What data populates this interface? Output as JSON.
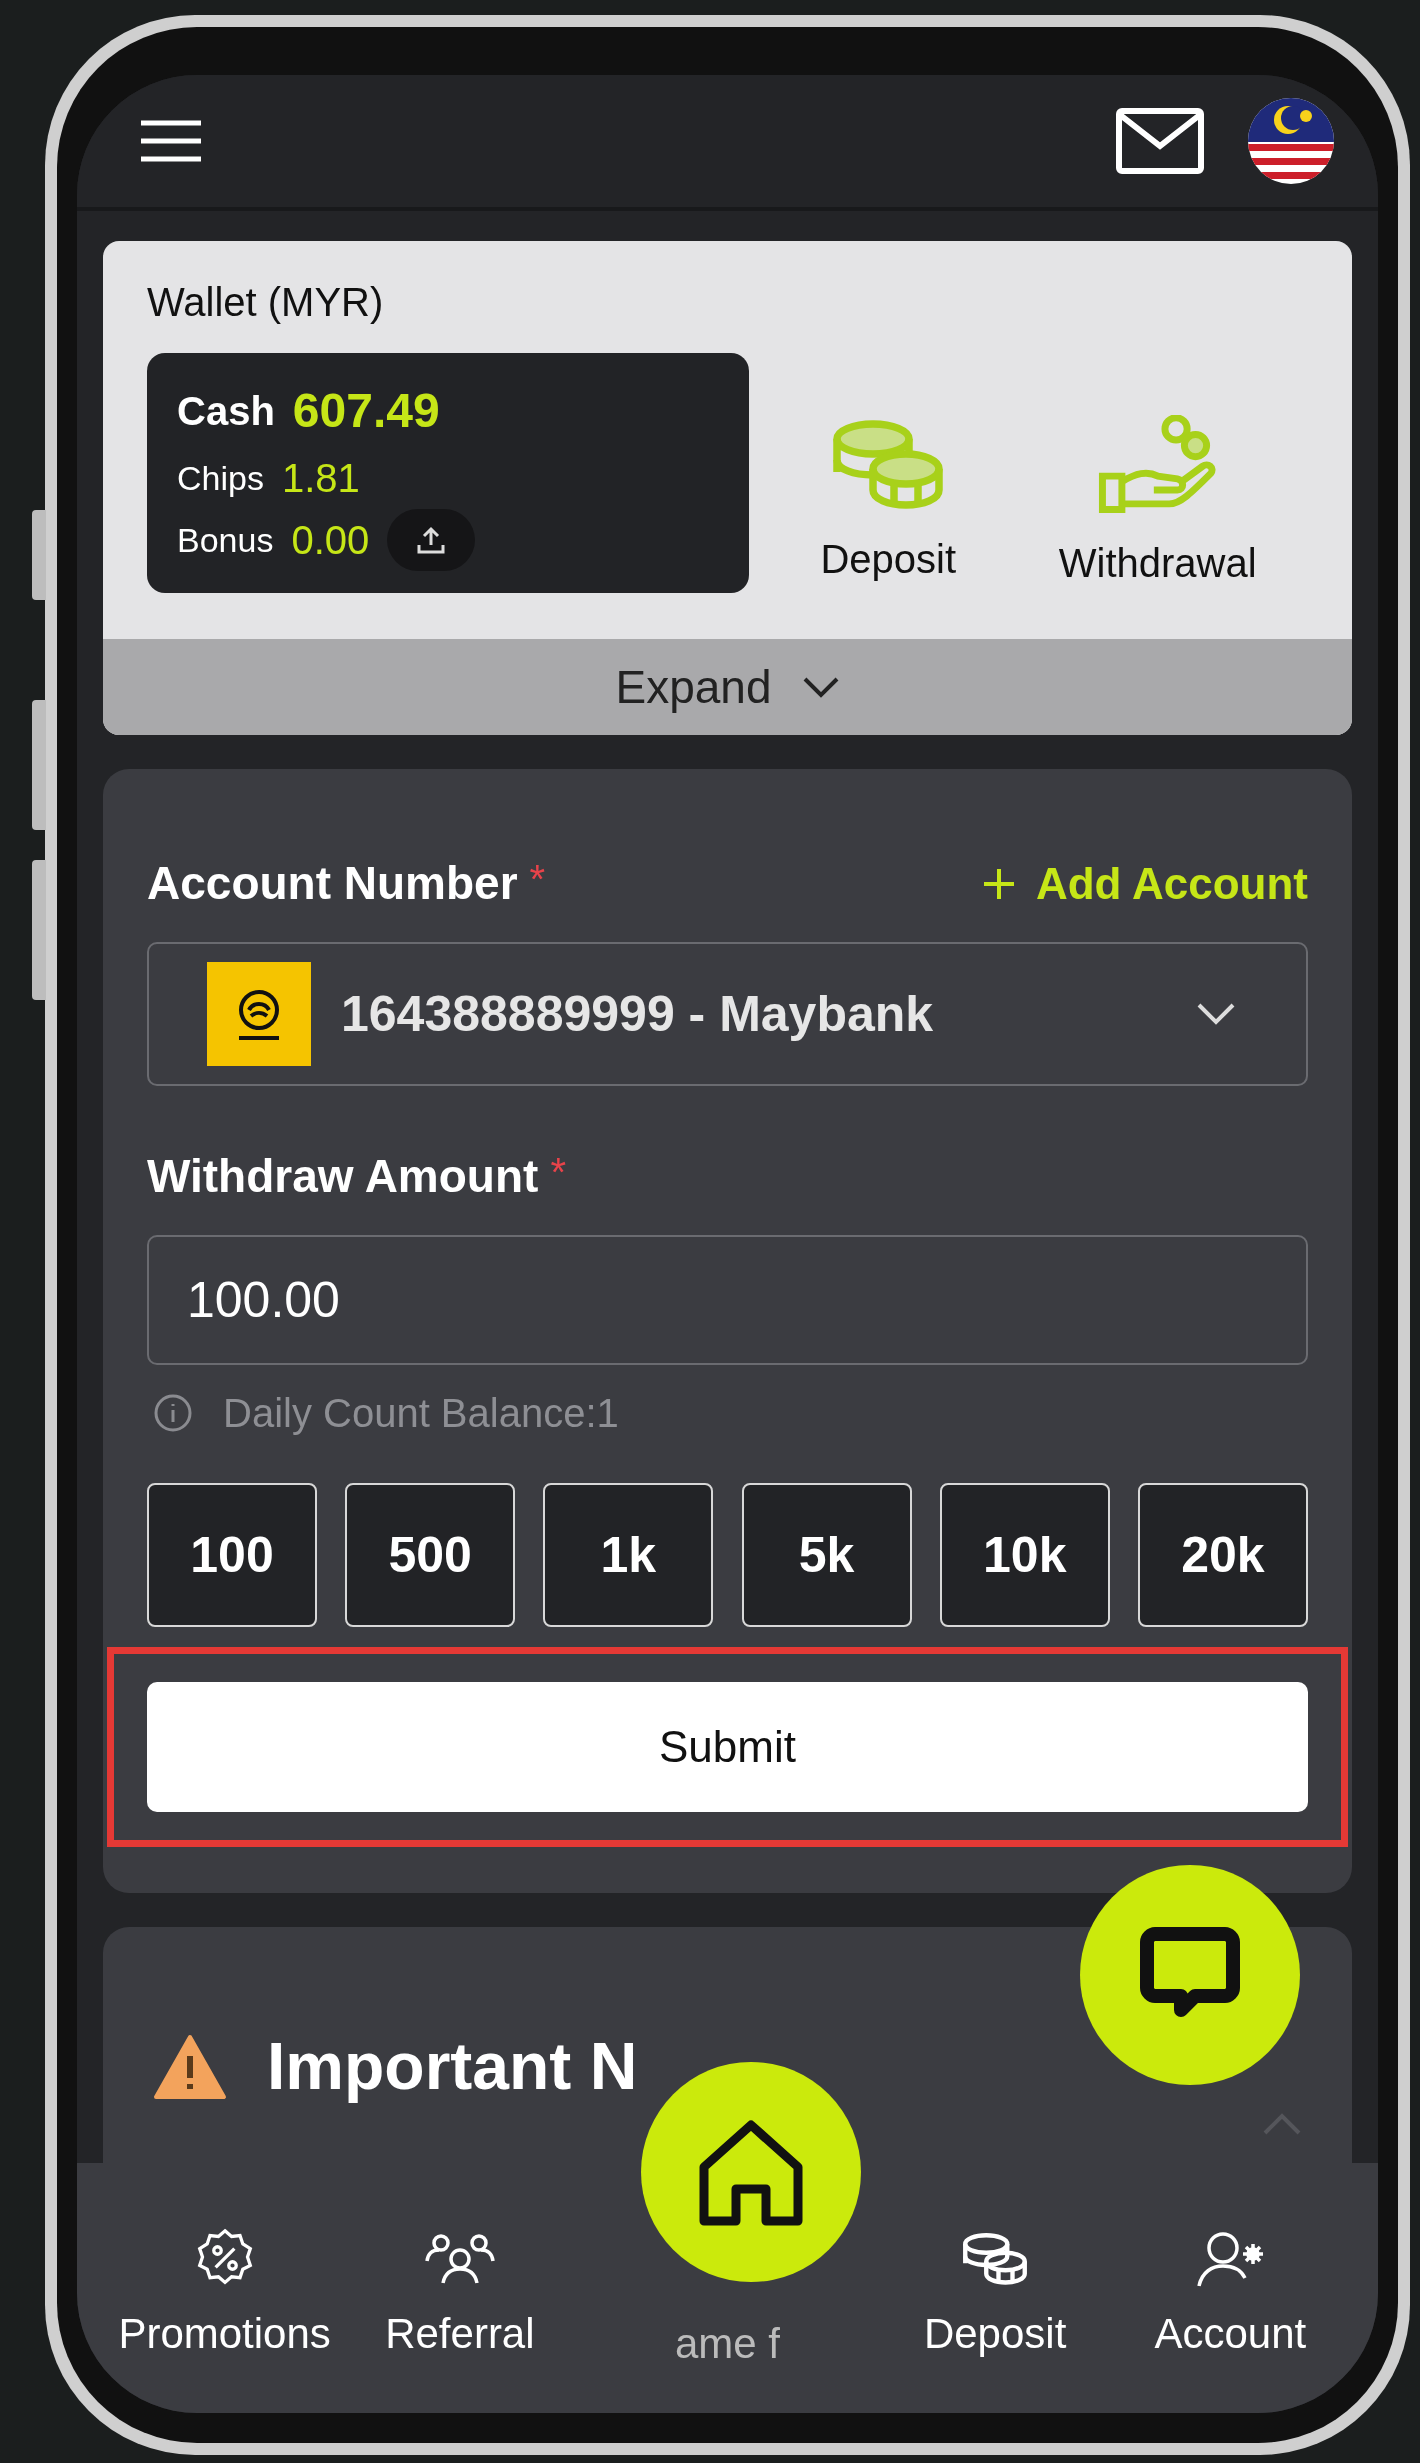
{
  "wallet": {
    "title": "Wallet (MYR)",
    "balances": [
      {
        "label": "Cash",
        "value": "607.49",
        "kind": "main"
      },
      {
        "label": "Chips",
        "value": "1.81",
        "kind": "sub"
      },
      {
        "label": "Bonus",
        "value": "0.00",
        "kind": "transfer"
      }
    ],
    "actions": [
      {
        "label": "Deposit",
        "kind": "coins"
      },
      {
        "label": "Withdrawal",
        "kind": "hand"
      }
    ],
    "expand": "Expand"
  },
  "form": {
    "account_label": "Account Number",
    "account_required": "*",
    "add_account": "Add Account",
    "account": "164388889999 - Maybank",
    "amount_label": "Withdraw Amount",
    "amount_required": "*",
    "amount_value": "100.00",
    "daily_note": "Daily Count Balance:1",
    "quick_amounts": [
      "100",
      "500",
      "1k",
      "5k",
      "10k",
      "20k"
    ],
    "submit": {
      "label": "Submit",
      "highlighted": true
    }
  },
  "notice": {
    "title": "Important N",
    "expanded": true
  },
  "bottom_nav": [
    {
      "label": "Promotions",
      "kind": "promo"
    },
    {
      "label": "Referral",
      "kind": "people"
    },
    {
      "label": "Deposit",
      "kind": "coins"
    },
    {
      "label": "Account",
      "kind": "account"
    }
  ],
  "covered_text": "ame f"
}
